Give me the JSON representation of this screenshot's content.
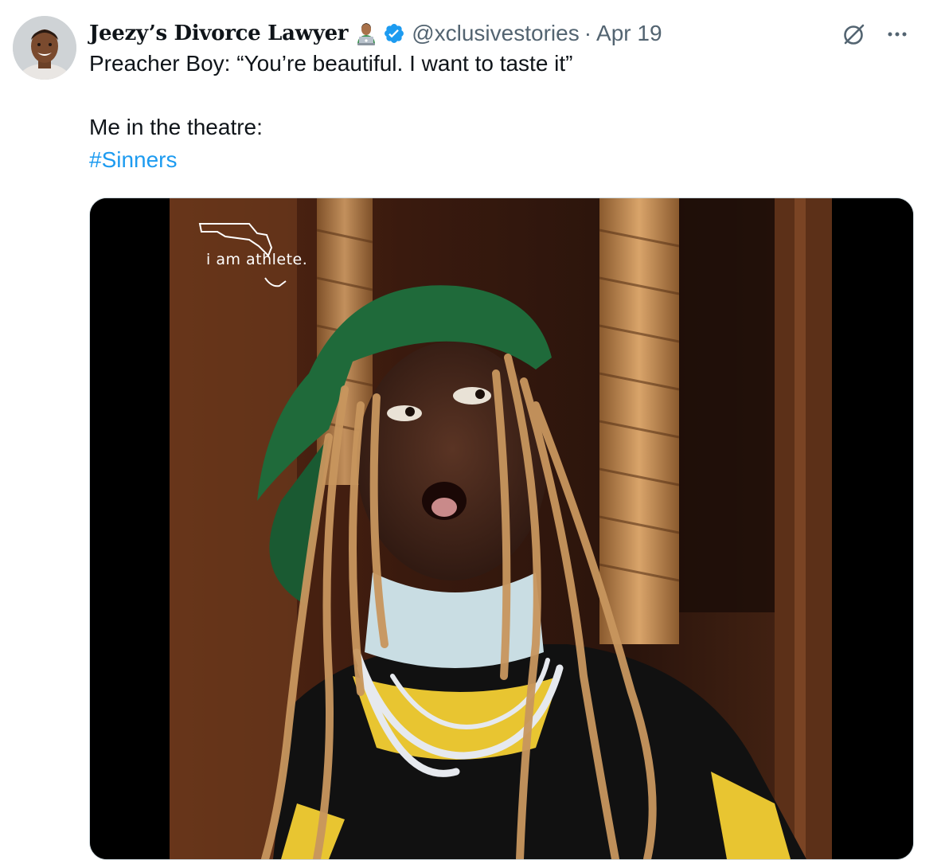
{
  "author": {
    "display_name": "Jeezy’s Divorce Lawyer",
    "emoji_icon": "man-technologist-emoji",
    "verified_icon": "verified-badge-icon",
    "handle": "@xclusivestories",
    "separator": "·",
    "date": "Apr 19"
  },
  "actions": {
    "grok_icon": "grok-icon",
    "more_icon": "more-options-icon"
  },
  "tweet": {
    "line1": "Preacher Boy: “You’re beautiful. I want to taste it”",
    "line2": "Me in the theatre:",
    "hashtag": "#Sinners"
  },
  "media": {
    "watermark_text": "i am athlete."
  },
  "colors": {
    "link": "#1d9bf0",
    "secondary_text": "#536471",
    "verified": "#1d9bf0"
  }
}
